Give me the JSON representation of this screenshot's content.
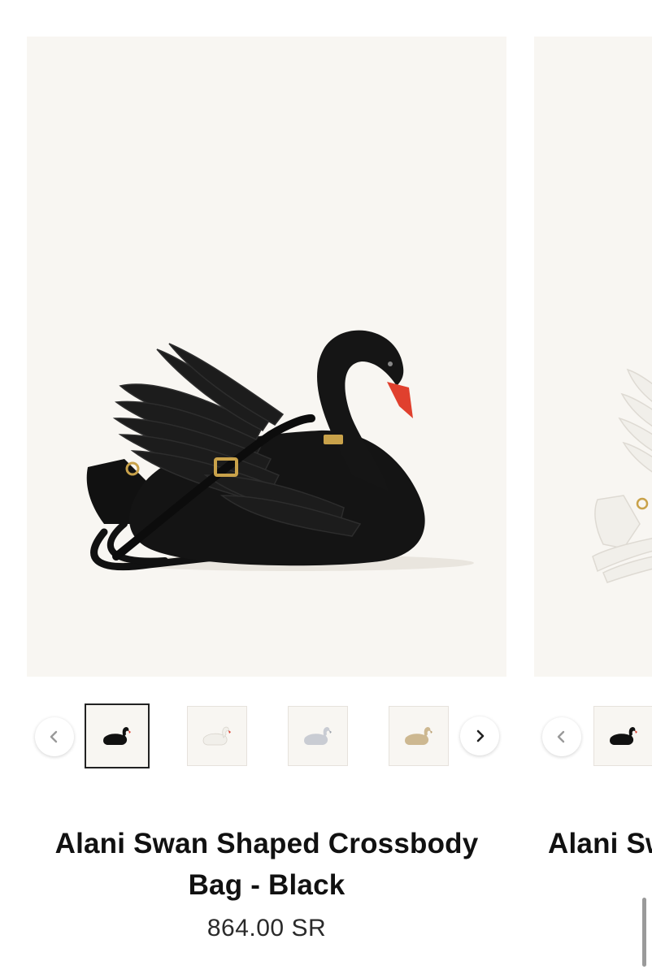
{
  "products": [
    {
      "title": "Alani Swan Shaped Crossbody Bag - Black",
      "price": "864.00 SR",
      "thumbnails": [
        {
          "variant": "black",
          "color": "#111111",
          "beak": "#d83a2a",
          "selected": true
        },
        {
          "variant": "white",
          "color": "#f1efea",
          "beak": "#d83a2a",
          "selected": false
        },
        {
          "variant": "silver",
          "color": "#c9ccd3",
          "beak": "#9aa0aa",
          "selected": false
        },
        {
          "variant": "gold",
          "color": "#cdb891",
          "beak": "#b79d6f",
          "selected": false
        }
      ],
      "icons": {
        "prev": "chevron-left-icon",
        "next": "chevron-right-icon"
      }
    },
    {
      "title": "Alani Sw",
      "thumbnails": [
        {
          "variant": "black",
          "color": "#111111",
          "beak": "#d83a2a",
          "selected": false
        }
      ],
      "icons": {
        "prev": "chevron-left-icon"
      }
    }
  ],
  "colors": {
    "image_background": "#f8f6f2",
    "black_swan": "#111111",
    "white_swan": "#f1efea",
    "beak": "#e0402e",
    "hardware_gold": "#c9a24a"
  }
}
